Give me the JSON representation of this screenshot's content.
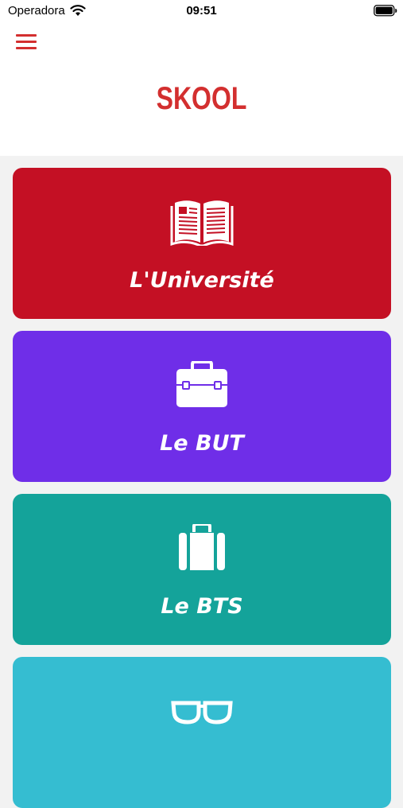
{
  "status_bar": {
    "carrier": "Operadora",
    "time": "09:51"
  },
  "header": {
    "title": "SKOOL",
    "menu_icon": "hamburger-menu-icon",
    "accent_color": "#d32f2f"
  },
  "cards": [
    {
      "label": "L'Université",
      "icon": "book-icon",
      "color": "#c41024"
    },
    {
      "label": "Le BUT",
      "icon": "toolbox-icon",
      "color": "#6f2ee8"
    },
    {
      "label": "Le BTS",
      "icon": "suitcase-icon",
      "color": "#14a39a"
    },
    {
      "label": "",
      "icon": "glasses-icon",
      "color": "#35bdd1"
    }
  ]
}
